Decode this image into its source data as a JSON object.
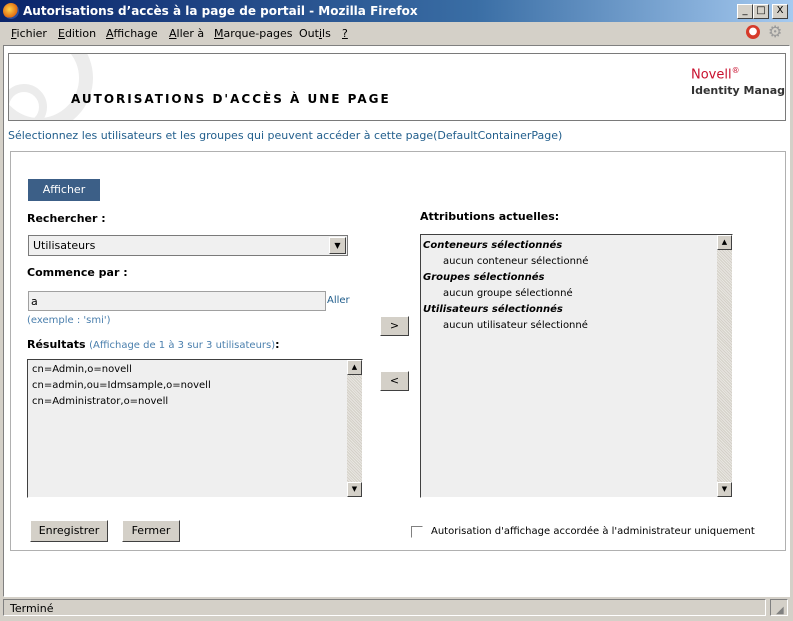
{
  "window": {
    "title": "Autorisations d’accès à la page de portail - Mozilla Firefox",
    "minimize_glyph": "_",
    "maximize_glyph": "□",
    "close_glyph": "X"
  },
  "menubar": {
    "items": [
      {
        "label": "Fichier",
        "accel": "F",
        "rest": "ichier"
      },
      {
        "label": "Edition",
        "accel": "E",
        "rest": "dition"
      },
      {
        "label": "Affichage",
        "accel": "A",
        "rest": "ffichage"
      },
      {
        "label": "Aller à",
        "accel": "A",
        "rest": "ller à"
      },
      {
        "label": "Marque-pages",
        "accel": "M",
        "rest": "arque-pages"
      },
      {
        "label": "Outils",
        "pre": "Out",
        "accel": "i",
        "rest": "ls"
      },
      {
        "label": "?",
        "accel": "?",
        "rest": ""
      }
    ],
    "stop_icon": "stop-icon",
    "throbber_icon": "gear-icon"
  },
  "banner": {
    "page_title": "AUTORISATIONS D'ACCÈS À UNE PAGE",
    "brand": "Novell",
    "brand_mark": "®",
    "product": "Identity Manager"
  },
  "instructions": "Sélectionnez les utilisateurs et les groupes qui peuvent accéder à cette page(DefaultContainerPage)",
  "form": {
    "show_button": "Afficher",
    "search_label": "Rechercher :",
    "search_select_value": "Utilisateurs",
    "starts_with_label": "Commence par :",
    "starts_with_value": "a",
    "go_link": "Aller",
    "example_hint": "(exemple : 'smi')",
    "results_label": "Résultats",
    "results_summary": "(Affichage de 1 à 3 sur 3 utilisateurs)",
    "results_colon": ":",
    "results": [
      "cn=Admin,o=novell",
      "cn=admin,ou=Idmsample,o=novell",
      "cn=Administrator,o=novell"
    ],
    "add_button": ">",
    "remove_button": "<",
    "assignments_label": "Attributions actuelles:",
    "assignments": {
      "containers_header": "Conteneurs sélectionnés",
      "containers_empty": "aucun conteneur sélectionné",
      "groups_header": "Groupes sélectionnés",
      "groups_empty": "aucun groupe sélectionné",
      "users_header": "Utilisateurs sélectionnés",
      "users_empty": "aucun utilisateur sélectionné"
    },
    "save_button": "Enregistrer",
    "close_button": "Fermer",
    "admin_only_checkbox_label": "Autorisation d'affichage accordée à l'administrateur uniquement",
    "admin_only_checked": false
  },
  "status": {
    "text": "Terminé"
  },
  "colors": {
    "title_bar": "#0a246a",
    "button_blue": "#3c5f87",
    "link_blue": "#215e8c",
    "brand_red": "#c8102e"
  }
}
